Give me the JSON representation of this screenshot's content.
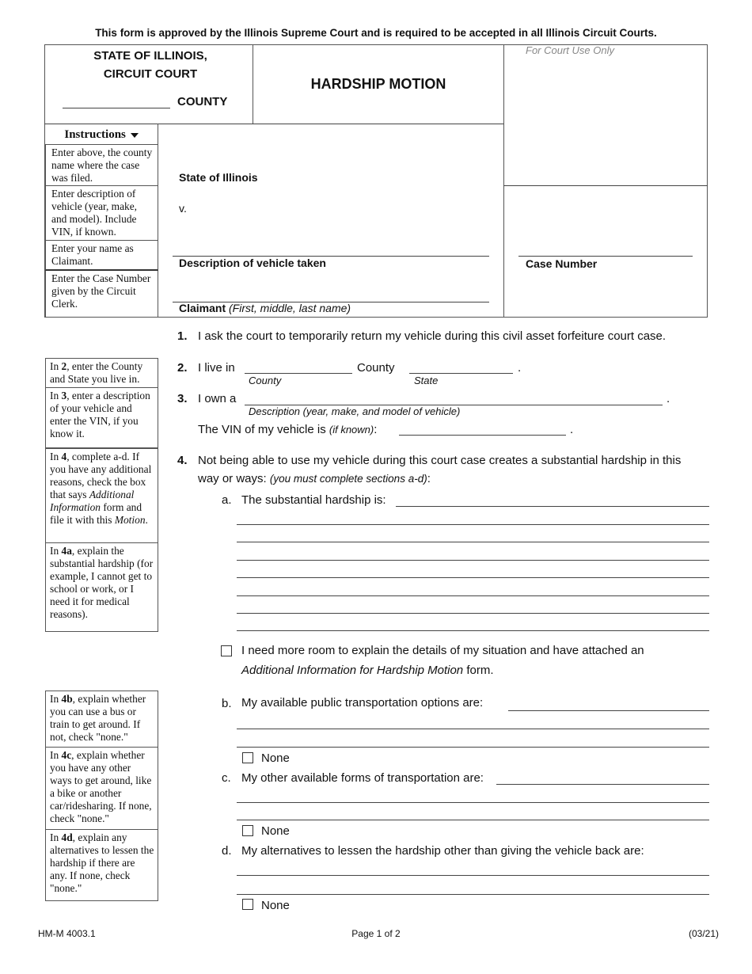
{
  "top_notice": "This form is approved by the Illinois Supreme Court and is required to be accepted in all Illinois Circuit Courts.",
  "header": {
    "state_line1": "STATE OF ILLINOIS,",
    "state_line2": "CIRCUIT COURT",
    "county_label": "COUNTY",
    "county_value": "",
    "form_title": "HARDSHIP MOTION",
    "court_use_only": "For Court Use Only"
  },
  "caption": {
    "plaintiff": "State of Illinois",
    "versus": "v.",
    "vehicle_label": "Description of vehicle taken",
    "vehicle_value": "",
    "claimant_label": "Claimant",
    "claimant_hint": "(First, middle, last name)",
    "claimant_value": "",
    "case_number_label": "Case Number",
    "case_number_value": ""
  },
  "instructions": {
    "heading": "Instructions",
    "heading_icon": "triangle-down-icon",
    "items": [
      "Enter above, the county name where the case was filed.",
      "Enter description of vehicle (year, make, and model). Include VIN, if known.",
      "Enter your name as Claimant.",
      "Enter the Case Number given by the Circuit Clerk."
    ]
  },
  "side_notes": {
    "n2": {
      "pre": "In ",
      "bold": "2",
      "post": ", enter the County and State you live in."
    },
    "n3": {
      "pre": "In ",
      "bold": "3",
      "post": ", enter a description of your vehicle and enter the VIN, if you know it."
    },
    "n4": {
      "pre": "In ",
      "bold": "4",
      "mid": ", complete a-d. If you have any additional reasons, check the box that says ",
      "ital1": "Additional Information",
      "mid2": " form and file it with this ",
      "ital2": "Motion",
      "end": "."
    },
    "n4a": {
      "pre": "In ",
      "bold": "4a",
      "post": ", explain the substantial hardship (for example, I cannot get to school or work, or I need it for medical reasons)."
    },
    "n4b": {
      "pre": "In ",
      "bold": "4b",
      "post": ", explain whether you can use a bus or train to get around. If not, check \"none.\""
    },
    "n4c": {
      "pre": "In ",
      "bold": "4c",
      "post": ", explain whether you have any other ways to get around, like a bike or another car/ridesharing. If none, check \"none.\""
    },
    "n4d": {
      "pre": "In ",
      "bold": "4d",
      "post": ", explain any alternatives to lessen the hardship if there are any. If none, check \"none.\""
    }
  },
  "body": {
    "item1": {
      "num": "1.",
      "text": "I ask the court to temporarily return my vehicle during this civil asset forfeiture court case."
    },
    "item2": {
      "num": "2.",
      "pre": "I live in",
      "mid": "County",
      "county_hint": "County",
      "state_hint": "State",
      "end": ".",
      "county_value": "",
      "state_value": ""
    },
    "item3": {
      "num": "3.",
      "pre": "I own a",
      "end": ".",
      "desc_hint": "Description (year, make, and model of vehicle)",
      "vin_pre": "The VIN of my vehicle is",
      "vin_hint": "(if known)",
      "vin_colon": ":",
      "vin_end": ".",
      "desc_value": "",
      "vin_value": ""
    },
    "item4": {
      "num": "4.",
      "line1": "Not being able to use my vehicle during this court case creates a substantial hardship in this",
      "line2_pre": "way or ways:",
      "line2_hint": "(you must complete sections a-d)",
      "line2_end": ":",
      "a": {
        "letter": "a.",
        "text": "The substantial hardship is:",
        "value": ""
      },
      "more_room": {
        "line1": "I need more room to explain the details of my situation and have attached an",
        "italic": "Additional Information for Hardship Motion",
        "end": " form.",
        "checked": false
      },
      "b": {
        "letter": "b.",
        "text": "My available public transportation options are:",
        "value": "",
        "none_label": "None",
        "none_checked": false
      },
      "c": {
        "letter": "c.",
        "text": "My other available forms of transportation are:",
        "value": "",
        "none_label": "None",
        "none_checked": false
      },
      "d": {
        "letter": "d.",
        "text": "My alternatives to lessen the hardship other than giving the vehicle back are:",
        "value": "",
        "none_label": "None",
        "none_checked": false
      }
    }
  },
  "footer": {
    "form_code": "HM-M 4003.1",
    "page": "Page 1 of 2",
    "revision": "(03/21)"
  }
}
